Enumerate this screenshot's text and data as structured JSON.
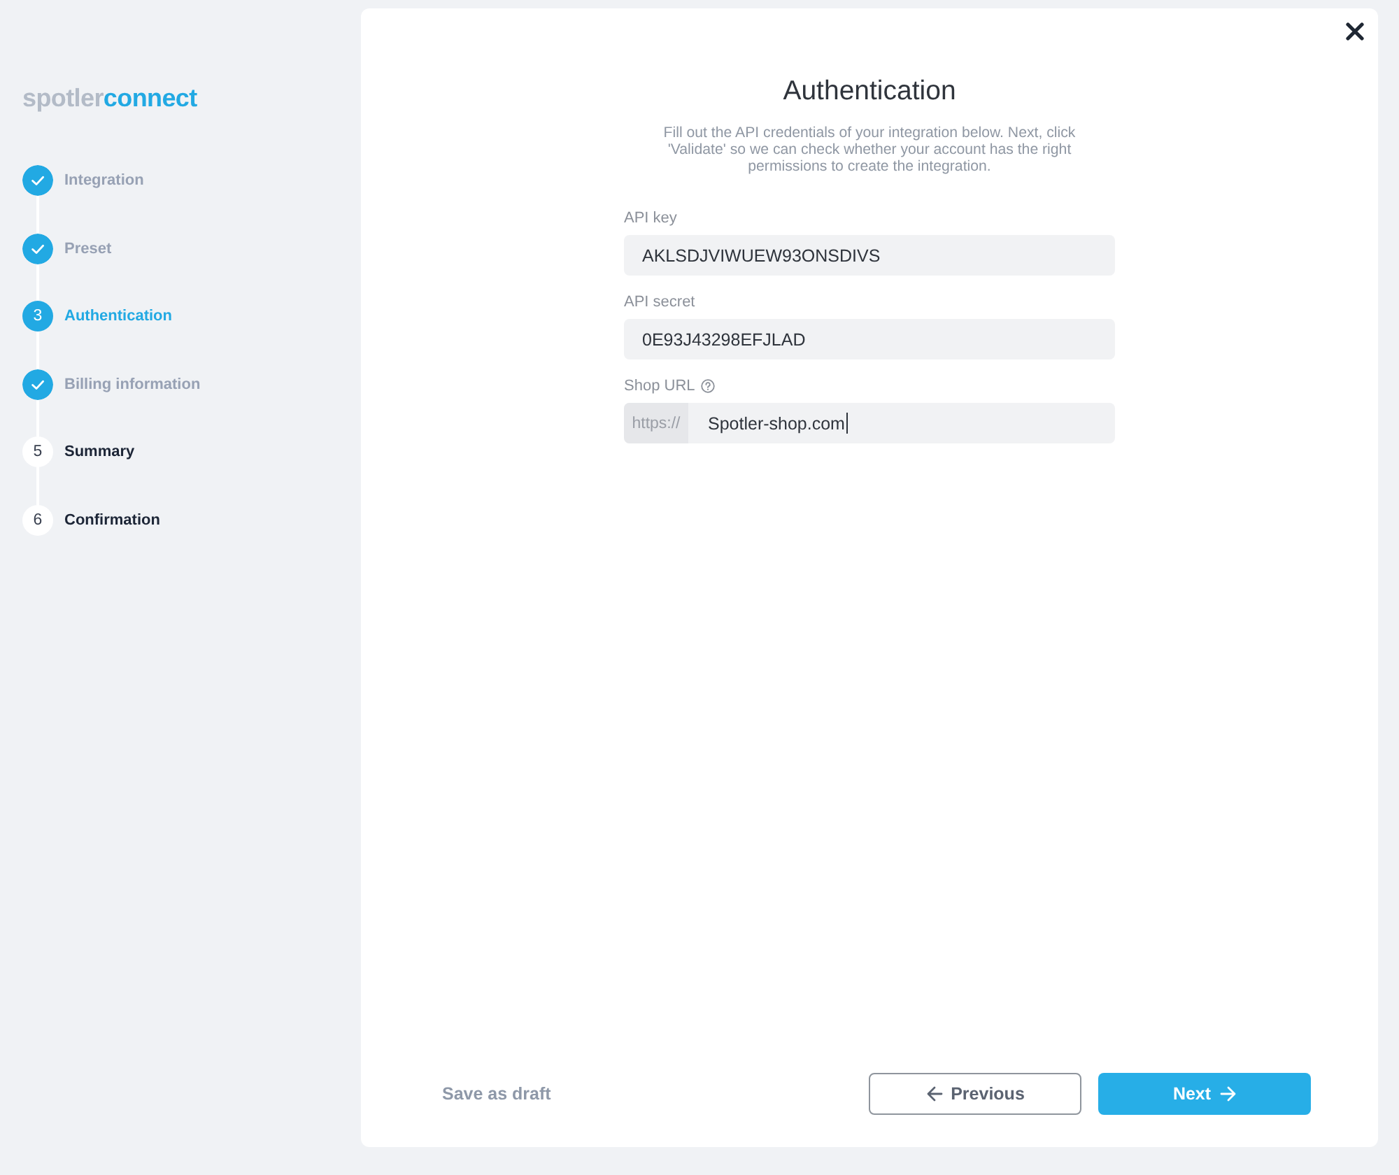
{
  "logo": {
    "brand": "spotler",
    "product": "connect"
  },
  "steps": [
    {
      "label": "Integration",
      "done": true,
      "selected": false
    },
    {
      "label": "Preset",
      "done": true,
      "selected": false
    },
    {
      "label": "Authentication",
      "number": "3",
      "done": false,
      "selected": true
    },
    {
      "label": "Billing information",
      "done": true,
      "selected": false
    },
    {
      "label": "Summary",
      "number": "5",
      "done": false,
      "selected": false
    },
    {
      "label": "Confirmation",
      "number": "6",
      "done": false,
      "selected": false
    }
  ],
  "card": {
    "title": "Authentication",
    "description": "Fill out the API credentials of your integration below. Next, click 'Validate' so we can check whether your account has the right permissions to create the integration."
  },
  "fields": [
    {
      "label": "API key",
      "value": "AKLSDJVIWUEW93ONSDIVS"
    },
    {
      "label": "API secret",
      "value": "0E93J43298EFJLAD"
    },
    {
      "label": "Shop URL",
      "help": true,
      "prefix": "https://",
      "value": "Spotler-shop.com",
      "focused": true
    }
  ],
  "footer": {
    "save_draft": "Save as draft",
    "previous": "Previous",
    "next": "Next"
  }
}
